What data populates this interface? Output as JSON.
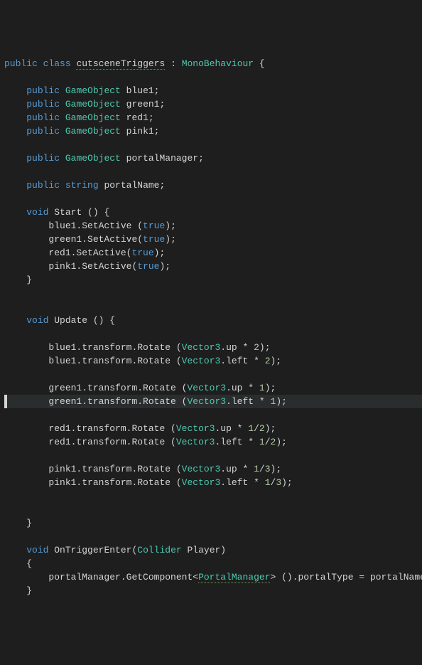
{
  "code": {
    "l1_public": "public",
    "l1_class": "class",
    "l1_name": "cutsceneTriggers",
    "l1_colon_space": " : ",
    "l1_base": "MonoBehaviour",
    "l1_brace": " {",
    "l3_mod": "public",
    "l3_type": "GameObject",
    "l3_name": " blue1;",
    "l4_mod": "public",
    "l4_type": "GameObject",
    "l4_name": " green1;",
    "l5_mod": "public",
    "l5_type": "GameObject",
    "l5_name": " red1;",
    "l6_mod": "public",
    "l6_type": "GameObject",
    "l6_name": " pink1;",
    "l8_mod": "public",
    "l8_type": "GameObject",
    "l8_name": " portalManager;",
    "l10_mod": "public",
    "l10_type": "string",
    "l10_name": " portalName;",
    "l12_void": "void",
    "l12_name": " Start () {",
    "l13_a": "blue1.SetActive (",
    "l13_true": "true",
    "l13_c": ");",
    "l14_a": "green1.SetActive(",
    "l14_true": "true",
    "l14_c": ");",
    "l15_a": "red1.SetActive(",
    "l15_true": "true",
    "l15_c": ");",
    "l16_a": "pink1.SetActive(",
    "l16_true": "true",
    "l16_c": ");",
    "l17_brace": "}",
    "l20_void": "void",
    "l20_name": " Update () {",
    "l22_a": "blue1.transform.Rotate (",
    "l22_v": "Vector3",
    "l22_b": ".up * ",
    "l22_n": "2",
    "l22_c": ");",
    "l23_a": "blue1.transform.Rotate (",
    "l23_v": "Vector3",
    "l23_b": ".left * ",
    "l23_n": "2",
    "l23_c": ");",
    "l25_a": "green1.transform.Rotate (",
    "l25_v": "Vector3",
    "l25_b": ".up * ",
    "l25_n": "1",
    "l25_c": ");",
    "l26_a": "green1.transform.Rotate (",
    "l26_v": "Vector3",
    "l26_b": ".left * ",
    "l26_n": "1",
    "l26_c": ");",
    "l28_a": "red1.transform.Rotate (",
    "l28_v": "Vector3",
    "l28_b": ".up * ",
    "l28_n1": "1",
    "l28_s": "/",
    "l28_n2": "2",
    "l28_c": ");",
    "l29_a": "red1.transform.Rotate (",
    "l29_v": "Vector3",
    "l29_b": ".left * ",
    "l29_n1": "1",
    "l29_s": "/",
    "l29_n2": "2",
    "l29_c": ");",
    "l31_a": "pink1.transform.Rotate (",
    "l31_v": "Vector3",
    "l31_b": ".up * ",
    "l31_n1": "1",
    "l31_s": "/",
    "l31_n2": "3",
    "l31_c": ");",
    "l32_a": "pink1.transform.Rotate (",
    "l32_v": "Vector3",
    "l32_b": ".left * ",
    "l32_n1": "1",
    "l32_s": "/",
    "l32_n2": "3",
    "l32_c": ");",
    "l35_brace": "}",
    "l37_void": "void",
    "l37_name": " OnTriggerEnter(",
    "l37_type": "Collider",
    "l37_param": " Player)",
    "l38_brace": "{",
    "l39_a": "portalManager.GetComponent<",
    "l39_type": "PortalManager",
    "l39_b": "> ().portalType = portalName;",
    "l40_brace": "}"
  }
}
